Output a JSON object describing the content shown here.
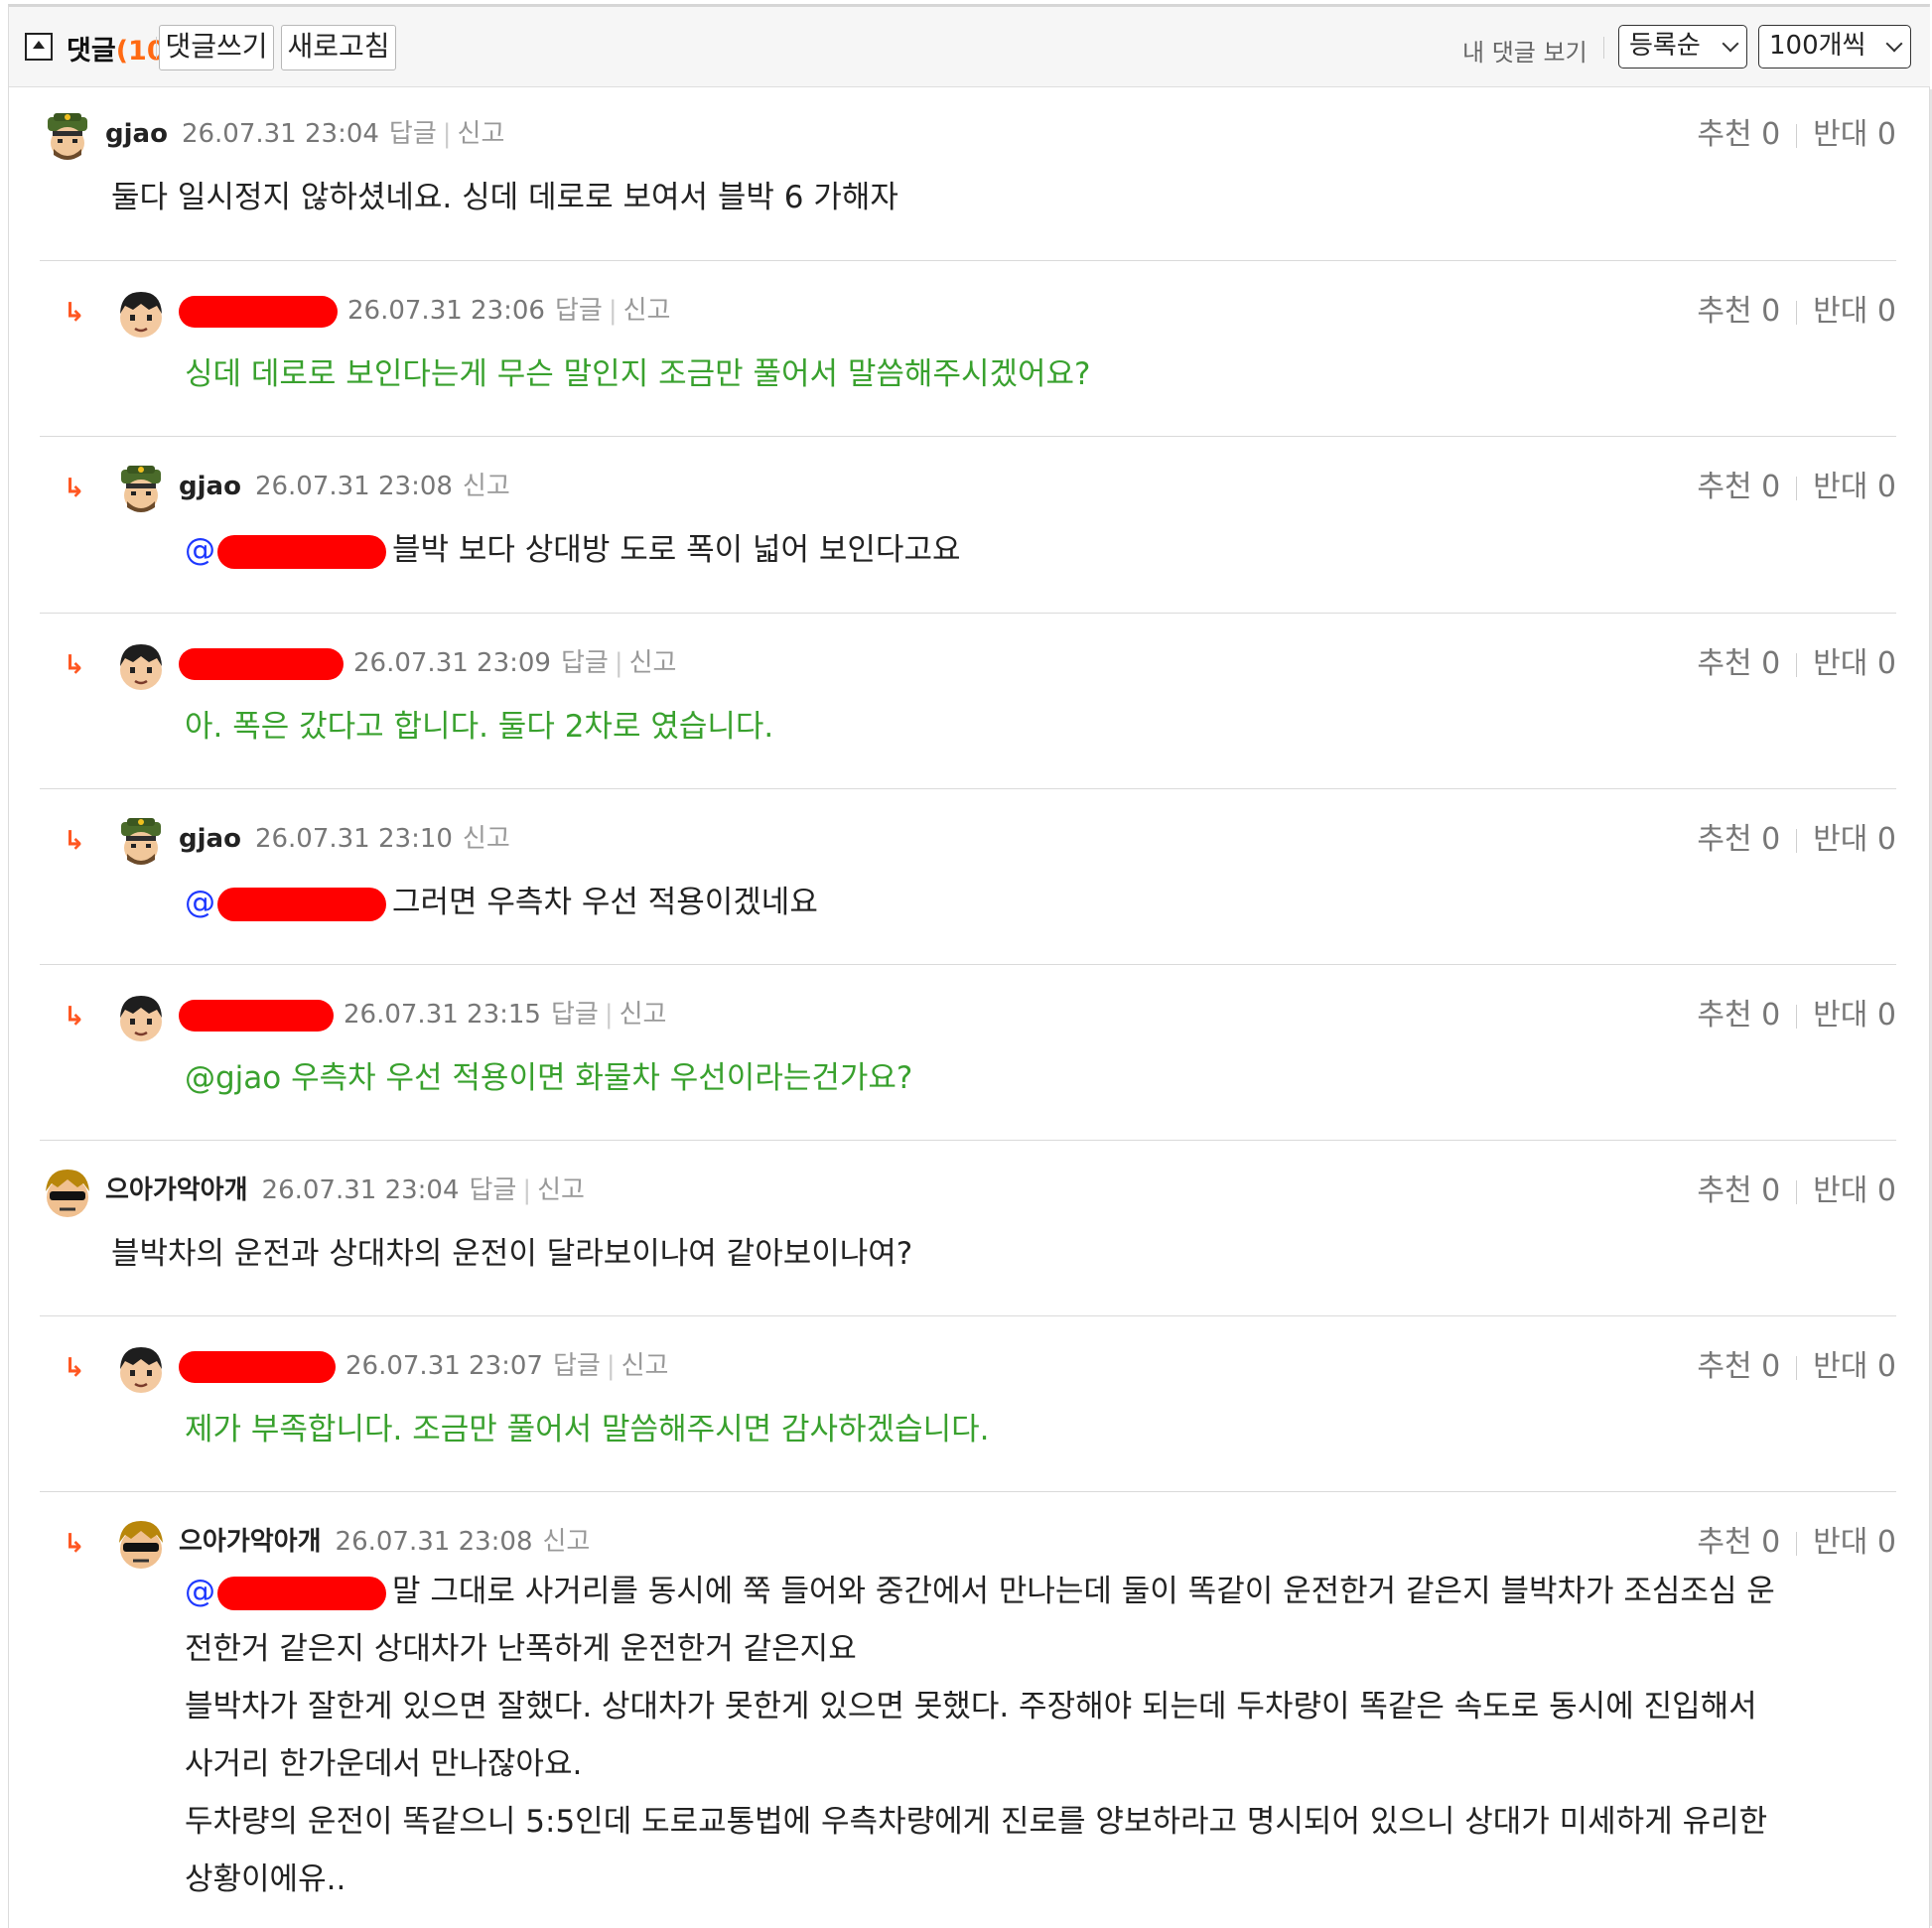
{
  "header": {
    "title": "댓글",
    "count": "(10)",
    "write_button": "댓글쓰기",
    "refresh_button": "새로고침",
    "my_comments": "내 댓글 보기",
    "sort_select": "등록순",
    "per_page_select": "100개씩"
  },
  "labels": {
    "reply": "답글",
    "report": "신고",
    "up": "추천",
    "down": "반대"
  },
  "comments": [
    {
      "nick": "gjao",
      "date": "26.07.31 23:04",
      "up": "추천 0",
      "down": "반대 0",
      "text": "둘다 일시정지 않하셨네요. 싱데 데로로 보여서 블박 6 가해자"
    },
    {
      "nick": "",
      "date": "26.07.31 23:06",
      "up": "추천 0",
      "down": "반대 0",
      "text": "싱데 데로로 보인다는게 무슨 말인지 조금만 풀어서 말씀해주시겠어요?"
    },
    {
      "nick": "gjao",
      "date": "26.07.31 23:08",
      "up": "추천 0",
      "down": "반대 0",
      "mention": "@",
      "text": "블박 보다 상대방 도로 폭이 넓어 보인다고요"
    },
    {
      "nick": "",
      "date": "26.07.31 23:09",
      "up": "추천 0",
      "down": "반대 0",
      "text": "아. 폭은 갔다고 합니다. 둘다 2차로 였습니다."
    },
    {
      "nick": "gjao",
      "date": "26.07.31 23:10",
      "up": "추천 0",
      "down": "반대 0",
      "mention": "@",
      "text": "그러면 우측차 우선 적용이겠네요"
    },
    {
      "nick": "",
      "date": "26.07.31 23:15",
      "up": "추천 0",
      "down": "반대 0",
      "text": "@gjao 우측차 우선 적용이면 화물차 우선이라는건가요?"
    },
    {
      "nick": "으아가악아개",
      "date": "26.07.31 23:04",
      "up": "추천 0",
      "down": "반대 0",
      "text": "블박차의 운전과 상대차의 운전이 달라보이나여 같아보이나여?"
    },
    {
      "nick": "",
      "date": "26.07.31 23:07",
      "up": "추천 0",
      "down": "반대 0",
      "text": "제가 부족합니다. 조금만 풀어서 말씀해주시면 감사하겠습니다."
    },
    {
      "nick": "으아가악아개",
      "date": "26.07.31 23:08",
      "up": "추천 0",
      "down": "반대 0",
      "mention": "@",
      "text": "말 그대로 사거리를 동시에 쭉 들어와 중간에서 만나는데 둘이 똑같이 운전한거 같은지 블박차가 조심조심 운\n전한거 같은지 상대차가 난폭하게 운전한거 같은지요\n블박차가 잘한게 있으면 잘했다. 상대차가 못한게 있으면 못했다. 주장해야 되는데 두차량이 똑같은 속도로 동시에 진입해서\n사거리 한가운데서 만나잖아요.\n두차량의 운전이 똑같으니 5:5인데 도로교통법에 우측차량에게 진로를 양보하라고 명시되어 있으니 상대가 미세하게 유리한\n상황이에유.."
    }
  ],
  "colors": {
    "accent": "#ff6a13",
    "reply_text": "#39a12e",
    "mention": "#1e38ff",
    "redaction": "#ff0000"
  }
}
